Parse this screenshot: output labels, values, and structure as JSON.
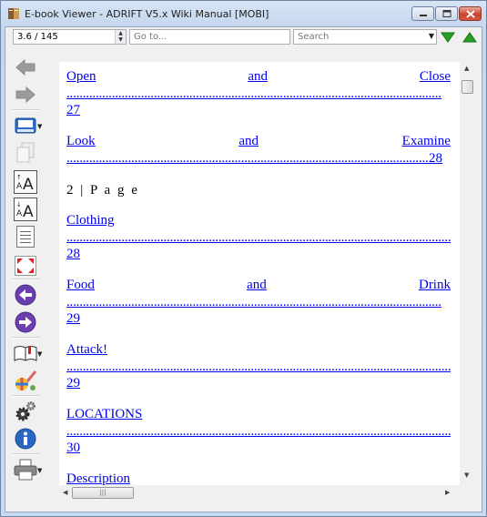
{
  "window": {
    "title": "E-book Viewer - ADRIFT V5.x Wiki Manual [MOBI]"
  },
  "toolbar": {
    "position_value": "3.6 / 145",
    "goto_placeholder": "Go to...",
    "search_placeholder": "Search"
  },
  "sidebar": {
    "icons": [
      "back-icon",
      "forward-icon",
      "save-icon",
      "copy-icon",
      "font-larger-icon",
      "font-smaller-icon",
      "table-of-contents-icon",
      "fullscreen-icon",
      "previous-page-icon",
      "next-page-icon",
      "bookmarks-icon",
      "preferences-icon",
      "settings-icon",
      "info-icon",
      "print-icon"
    ]
  },
  "document": {
    "entries": [
      {
        "words": [
          "Open",
          "and",
          "Close"
        ],
        "page": "27"
      },
      {
        "words": [
          "Look",
          "and",
          "Examine"
        ],
        "page": "28"
      },
      {
        "single": "Clothing",
        "page": "28"
      },
      {
        "words": [
          "Food",
          "and",
          "Drink"
        ],
        "page": "29"
      },
      {
        "single": "Attack!",
        "page": "29"
      },
      {
        "single": "LOCATIONS",
        "page": "30"
      },
      {
        "single": "Description",
        "page": ""
      }
    ],
    "page_header": "2 | P a g e"
  },
  "colors": {
    "link": "#0000ee",
    "accent": "#2b9a2b"
  }
}
